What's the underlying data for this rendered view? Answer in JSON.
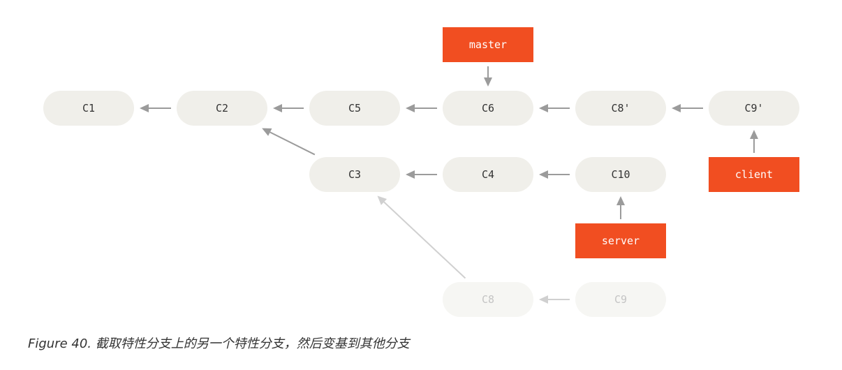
{
  "diagram": {
    "nodes": [
      {
        "id": "C1",
        "label": "C1",
        "faded": false
      },
      {
        "id": "C2",
        "label": "C2",
        "faded": false
      },
      {
        "id": "C5",
        "label": "C5",
        "faded": false
      },
      {
        "id": "C6",
        "label": "C6",
        "faded": false
      },
      {
        "id": "C8p",
        "label": "C8'",
        "faded": false
      },
      {
        "id": "C9p",
        "label": "C9'",
        "faded": false
      },
      {
        "id": "C3",
        "label": "C3",
        "faded": false
      },
      {
        "id": "C4",
        "label": "C4",
        "faded": false
      },
      {
        "id": "C10",
        "label": "C10",
        "faded": false
      },
      {
        "id": "C8",
        "label": "C8",
        "faded": true
      },
      {
        "id": "C9",
        "label": "C9",
        "faded": true
      }
    ],
    "refs": [
      {
        "id": "master",
        "label": "master",
        "points_to": "C6"
      },
      {
        "id": "client",
        "label": "client",
        "points_to": "C9p"
      },
      {
        "id": "server",
        "label": "server",
        "points_to": "C10"
      }
    ],
    "edges": [
      {
        "from": "C2",
        "to": "C1",
        "faded": false
      },
      {
        "from": "C5",
        "to": "C2",
        "faded": false
      },
      {
        "from": "C6",
        "to": "C5",
        "faded": false
      },
      {
        "from": "C8p",
        "to": "C6",
        "faded": false
      },
      {
        "from": "C9p",
        "to": "C8p",
        "faded": false
      },
      {
        "from": "C3",
        "to": "C2",
        "faded": false
      },
      {
        "from": "C4",
        "to": "C3",
        "faded": false
      },
      {
        "from": "C10",
        "to": "C4",
        "faded": false
      },
      {
        "from": "C8",
        "to": "C3",
        "faded": true
      },
      {
        "from": "C9",
        "to": "C8",
        "faded": true
      }
    ],
    "colors": {
      "node_fill": "#f0efea",
      "ref_fill": "#f14e21",
      "edge": "#9b9b9b"
    }
  },
  "caption": {
    "text": "Figure 40. 截取特性分支上的另一个特性分支，然后变基到其他分支"
  }
}
